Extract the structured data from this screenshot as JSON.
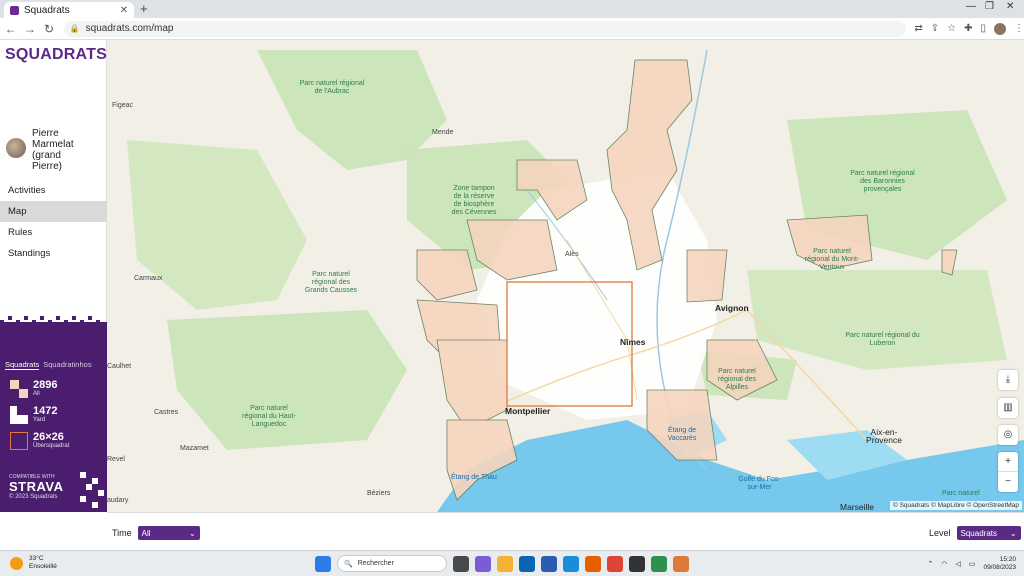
{
  "browser": {
    "tab_title": "Squadrats",
    "url": "squadrats.com/map"
  },
  "sidebar": {
    "brand": "SQUADRATS",
    "user_name": "Pierre Marmelat (grand Pierre)",
    "menu": [
      {
        "label": "Activities",
        "active": false
      },
      {
        "label": "Map",
        "active": true
      },
      {
        "label": "Rules",
        "active": false
      },
      {
        "label": "Standings",
        "active": false
      }
    ],
    "stats": {
      "tabs": [
        "Squadrats",
        "Squadratinhos"
      ],
      "all_value": "2896",
      "all_label": "All",
      "yard_value": "1472",
      "yard_label": "Yard",
      "uber_value": "26×26",
      "uber_label": "Übersquadrat"
    },
    "strava": {
      "compatible": "COMPATIBLE WITH",
      "name": "STRAVA",
      "copyright": "© 2023 Squadrats"
    }
  },
  "map": {
    "cities": [
      "Figeac",
      "Mende",
      "Alès",
      "Avignon",
      "Nîmes",
      "Montpellier",
      "Carmaux",
      "Castres",
      "Mazamet",
      "Revel",
      "Béziers",
      "Aix-en-Provence",
      "Marseille",
      "Caulhet",
      "audary"
    ],
    "parks": [
      "Parc naturel régional de l'Aubrac",
      "Zone tampon de la réserve de biosphère des Cévennes",
      "Parc naturel régional des Grands Causses",
      "Parc naturel régional du Haut-Languedoc",
      "Parc naturel régional des Baronnies provençales",
      "Parc naturel régional du Mont-Ventoux",
      "Parc naturel régional du Luberon",
      "Parc naturel régional des Alpilles",
      "Parc naturel"
    ],
    "water": [
      "Étang de Vaccarès",
      "Étang de Thau",
      "Golfe du Fos-sur-Mer"
    ],
    "attribution": "© Squadrats © MapLibre © OpenStreetMap",
    "controls": [
      "download-icon",
      "layers-icon",
      "locate-icon",
      "zoom-in-icon",
      "zoom-out-icon"
    ]
  },
  "filters": {
    "time_label": "Time",
    "time_value": "All",
    "level_label": "Level",
    "level_value": "Squadrats"
  },
  "taskbar": {
    "temperature": "33°C",
    "weather": "Ensoleillé",
    "search_placeholder": "Rechercher",
    "time": "15:20",
    "date": "09/08/2023"
  },
  "colors": {
    "brand": "#5b2a86",
    "sidebar_stats_bg": "#4a1d6e",
    "squadrat_fill": "#f6d5bf",
    "squadrat_edge": "#5d7a5a",
    "ubersquadrat": "#e0783a",
    "park": "#c9e3b5",
    "sea": "#76c8ec"
  }
}
